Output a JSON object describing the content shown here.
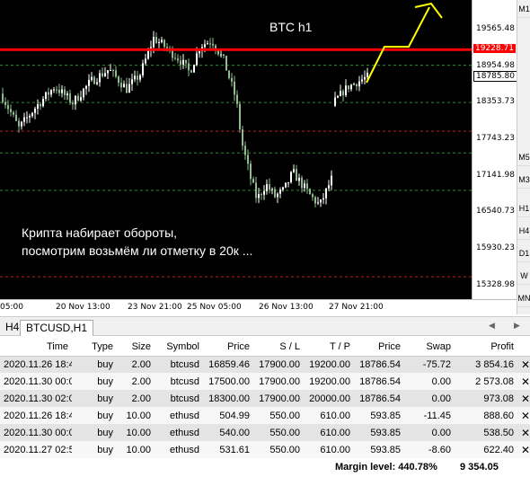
{
  "chart": {
    "title": "BTC h1",
    "caption": "Крипта набирает обороты,\nпосмотрим возьмём ли отметку в 20к ...",
    "colors": {
      "background": "#000000",
      "bull": "#ffffff",
      "bear": "#8fbc8f",
      "resistance": "#ff0000",
      "projection": "#ffff00",
      "level_red": "#c02020",
      "level_green": "#2e8b2e"
    },
    "price_ticks": [
      "19565.48",
      "18954.98",
      "18353.73",
      "17743.23",
      "17141.98",
      "16540.73",
      "15930.23",
      "15328.98"
    ],
    "price_tags": [
      {
        "label": "19228.71",
        "bg": "#ff0000",
        "fg": "#ffffff"
      },
      {
        "label": "18785.80",
        "bg": "#ffffff",
        "fg": "#000000"
      }
    ],
    "time_ticks": [
      "05:00",
      "20 Nov 13:00",
      "23 Nov 21:00",
      "25 Nov 05:00",
      "26 Nov 13:00",
      "27 Nov 21:00"
    ],
    "scale": {
      "min": 15100,
      "max": 20050
    }
  },
  "right_panel": {
    "buttons": [
      "M1",
      "M5",
      "M3",
      "H1",
      "H4",
      "D1",
      "W",
      "MN"
    ]
  },
  "tabs": {
    "prev_label": "H4",
    "active_label": "BTCUSD,H1"
  },
  "table": {
    "headers": [
      "Time",
      "Type",
      "Size",
      "Symbol",
      "Price",
      "S / L",
      "T / P",
      "Price",
      "Swap",
      "Profit"
    ],
    "rows": [
      [
        "2020.11.26 18:42...",
        "buy",
        "2.00",
        "btcusd",
        "16859.46",
        "17900.00",
        "19200.00",
        "18786.54",
        "-75.72",
        "3 854.16"
      ],
      [
        "2020.11.30 00:05...",
        "buy",
        "2.00",
        "btcusd",
        "17500.00",
        "17900.00",
        "19200.00",
        "18786.54",
        "0.00",
        "2 573.08"
      ],
      [
        "2020.11.30 02:04...",
        "buy",
        "2.00",
        "btcusd",
        "18300.00",
        "17900.00",
        "20000.00",
        "18786.54",
        "0.00",
        "973.08"
      ],
      [
        "2020.11.26 18:44...",
        "buy",
        "10.00",
        "ethusd",
        "504.99",
        "550.00",
        "610.00",
        "593.85",
        "-11.45",
        "888.60"
      ],
      [
        "2020.11.30 00:05...",
        "buy",
        "10.00",
        "ethusd",
        "540.00",
        "550.00",
        "610.00",
        "593.85",
        "0.00",
        "538.50"
      ],
      [
        "2020.11.27 02:53...",
        "buy",
        "10.00",
        "ethusd",
        "531.61",
        "550.00",
        "610.00",
        "593.85",
        "-8.60",
        "622.40"
      ]
    ]
  },
  "summary": {
    "margin_level": "Margin level: 440.78%",
    "total_profit": "9 354.05"
  }
}
